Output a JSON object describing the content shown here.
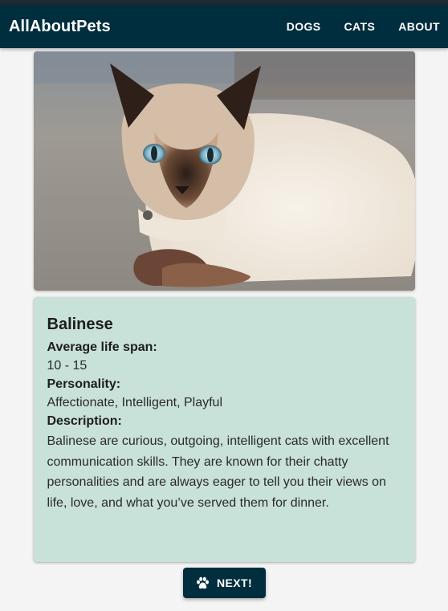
{
  "app": {
    "title": "AllAboutPets"
  },
  "nav": {
    "items": [
      "DOGS",
      "CATS",
      "ABOUT"
    ]
  },
  "photo": {
    "subject": "Siamese-colored cat lying down",
    "icon": "cat-photo"
  },
  "breed": {
    "name": "Balinese",
    "life_span_label": "Average life span:",
    "life_span_value": "10 - 15",
    "personality_label": "Personality:",
    "personality_value": "Affectionate, Intelligent, Playful",
    "description_label": "Description:",
    "description_value": "Balinese are curious, outgoing, intelligent cats with excellent communication skills. They are known for their chatty personalities and are always eager to tell you their views on life, love, and what you’ve served them for dinner."
  },
  "next_button": {
    "label": "NEXT!",
    "icon": "paw-icon"
  },
  "colors": {
    "appbar": "#002e3e",
    "card": "#c8e1d9",
    "background": "#f4f4f4"
  }
}
